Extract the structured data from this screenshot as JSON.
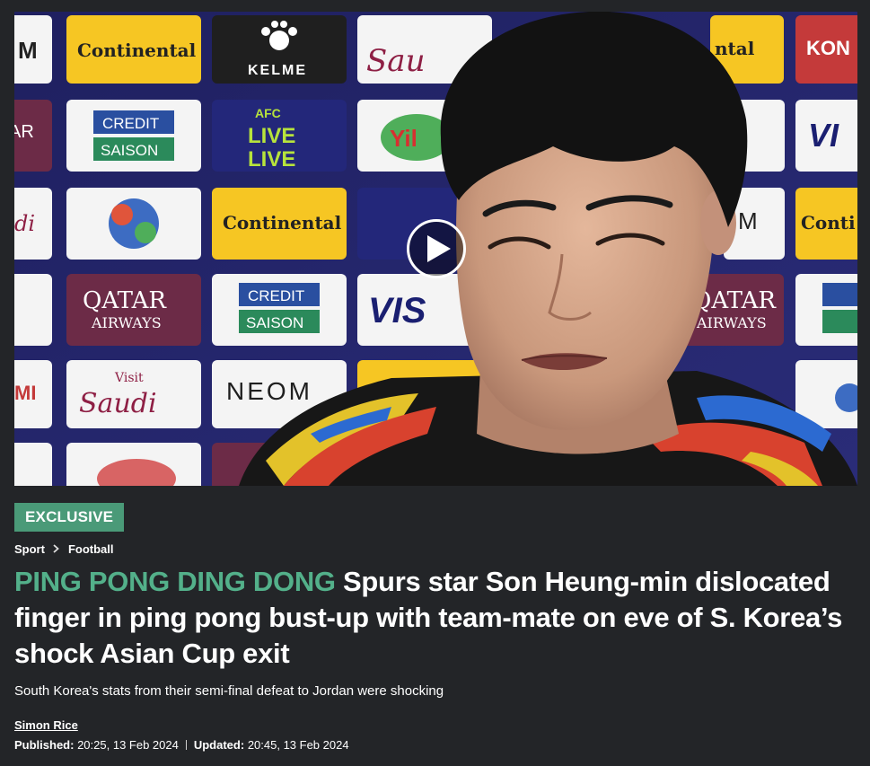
{
  "video": {
    "sponsor_boards": [
      "Continental",
      "KELME",
      "Visit Saudi",
      "CREDIT SAISON",
      "AFC LIVE",
      "Yili",
      "QATAR AIRWAYS",
      "VISA",
      "NEOM",
      "KONAMI"
    ]
  },
  "tag": {
    "label": "EXCLUSIVE"
  },
  "breadcrumb": {
    "items": [
      "Sport",
      "Football"
    ]
  },
  "headline": {
    "kicker": "PING PONG DING DONG",
    "text": "Spurs star Son Heung-min dislocated finger in ping pong bust-up with team-mate on eve of S. Korea’s shock Asian Cup exit"
  },
  "standfirst": "South Korea's stats from their semi-final defeat to Jordan were shocking",
  "byline": {
    "author": "Simon Rice",
    "published_label": "Published:",
    "published": "20:25, 13 Feb 2024",
    "updated_label": "Updated:",
    "updated": "20:45, 13 Feb 2024"
  },
  "colors": {
    "background": "#232528",
    "accent": "#53b08a",
    "tag": "#4a9a78"
  },
  "icons": [
    "play-icon",
    "chevron-right-icon"
  ]
}
